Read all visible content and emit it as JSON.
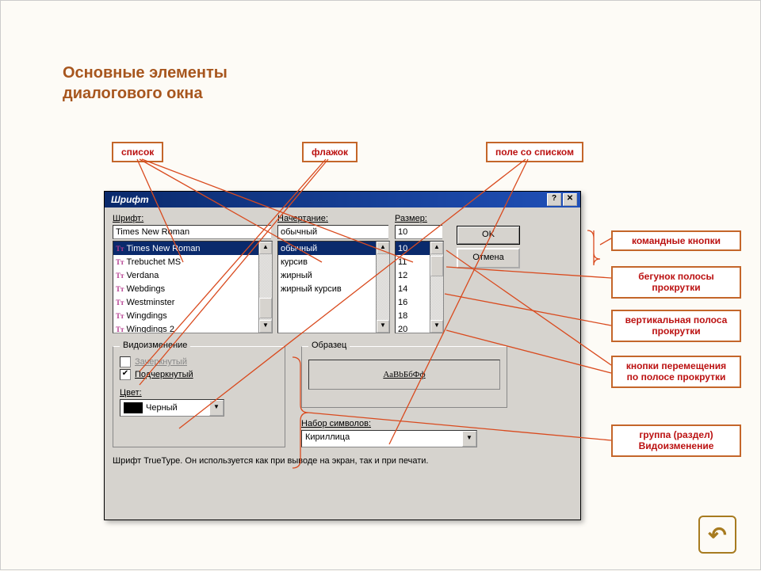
{
  "slide": {
    "title_line1": "Основные элементы",
    "title_line2": "диалогового окна"
  },
  "annotations": {
    "top": {
      "list": "список",
      "checkbox": "флажок",
      "combobox": "поле со списком"
    },
    "right": {
      "command_buttons": "командные кнопки",
      "scroll_thumb": "бегунок полосы прокрутки",
      "vscrollbar": "вертикальная полоса прокрутки",
      "scroll_btns": "кнопки перемещения по полосе прокрутки",
      "group": "группа (раздел) Видоизменение"
    }
  },
  "dialog": {
    "title": "Шрифт",
    "help_symbol": "?",
    "close_symbol": "✕",
    "font_label": "Шрифт:",
    "style_label": "Начертание:",
    "size_label": "Размер:",
    "font_value": "Times New Roman",
    "style_value": "обычный",
    "size_value": "10",
    "font_items": [
      "Times New Roman",
      "Trebuchet MS",
      "Verdana",
      "Webdings",
      "Westminster",
      "Wingdings",
      "Wingdings 2"
    ],
    "style_items": [
      "обычный",
      "курсив",
      "жирный",
      "жирный курсив"
    ],
    "size_items": [
      "10",
      "11",
      "12",
      "14",
      "16",
      "18",
      "20"
    ],
    "ok": "OK",
    "cancel": "Отмена",
    "mod_group_title": "Видоизменение",
    "strike": "Зачеркнутый",
    "underline": "Подчеркнутый",
    "color_label": "Цвет:",
    "color_value": "Черный",
    "sample_group_title": "Образец",
    "sample_text": "АаВbБбФф",
    "script_label": "Набор символов:",
    "script_value": "Кириллица",
    "hint": "Шрифт TrueType. Он используется как при выводе на экран, так и при печати."
  }
}
